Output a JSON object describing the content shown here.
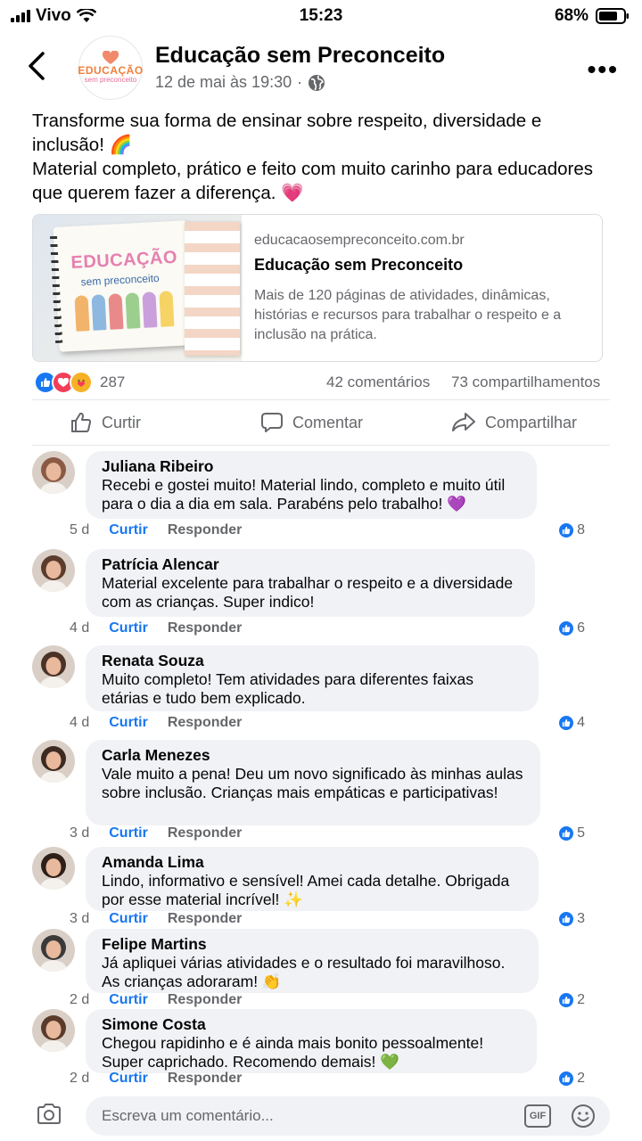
{
  "status_bar": {
    "carrier": "Vivo",
    "time": "15:23",
    "battery": "68%"
  },
  "post": {
    "page_name": "Educação sem Preconceito",
    "logo_line1": "EDUCAÇÃO",
    "logo_line2": "sem preconceito",
    "timestamp": "12 de mai às 19:30",
    "separator": "·",
    "text_line1": "Transforme sua forma de ensinar sobre respeito, diversidade e inclusão! 🌈",
    "text_line2": "Material completo, prático e feito com muito carinho para educadores que querem fazer a diferença. 💗",
    "link": {
      "domain": "educacaosempreconceito.com.br",
      "title": "Educação sem Preconceito",
      "description": "Mais de 120 páginas de atividades, dinâmicas, histórias e recursos para trabalhar o respeito e a inclusão na prática.",
      "image_title": "EDUCAÇÃO",
      "image_subtitle": "sem preconceito"
    },
    "reaction_count": "287",
    "comments_count": "42 comentários",
    "shares_count": "73 compartilhamentos"
  },
  "actions": {
    "like": "Curtir",
    "comment": "Comentar",
    "share": "Compartilhar"
  },
  "comment_actions": {
    "like": "Curtir",
    "reply": "Responder"
  },
  "comments": [
    {
      "name": "Juliana Ribeiro",
      "text": "Recebi e gostei muito! Material lindo, completo e muito útil para o dia a dia em sala. Parabéns pelo trabalho! 💜",
      "age": "5 d",
      "likes": "8",
      "avatar_color": "#8a5a44"
    },
    {
      "name": "Patrícia Alencar",
      "text": "Material excelente para trabalhar o respeito e a diversidade com as crianças. Super indico!",
      "age": "4 d",
      "likes": "6",
      "avatar_color": "#5b3b2c"
    },
    {
      "name": "Renata Souza",
      "text": "Muito completo! Tem atividades para diferentes faixas etárias e tudo bem explicado.",
      "age": "4 d",
      "likes": "4",
      "avatar_color": "#4a3226"
    },
    {
      "name": "Carla Menezes",
      "text": "Vale muito a pena! Deu um novo significado às minhas aulas sobre inclusão. Crianças mais empáticas e participativas!",
      "age": "3 d",
      "likes": "5",
      "avatar_color": "#3d2a20"
    },
    {
      "name": "Amanda Lima",
      "text": "Lindo, informativo e sensível! Amei cada detalhe. Obrigada por esse material incrível! ✨",
      "age": "3 d",
      "likes": "3",
      "avatar_color": "#2e1f18"
    },
    {
      "name": "Felipe Martins",
      "text": "Já apliquei várias atividades e o resultado foi maravilhoso. As crianças adoraram! 👏",
      "age": "2 d",
      "likes": "2",
      "avatar_color": "#3a3a3a"
    },
    {
      "name": "Simone Costa",
      "text": "Chegou rapidinho e é ainda mais bonito pessoalmente! Super caprichado. Recomendo demais! 💚",
      "age": "2 d",
      "likes": "2",
      "avatar_color": "#5a3a2a"
    }
  ],
  "composer": {
    "placeholder": "Escreva um comentário...",
    "gif": "GIF"
  },
  "icons": [
    "back-arrow-icon",
    "globe-icon",
    "more-icon",
    "like-icon",
    "comment-icon",
    "share-icon",
    "camera-icon",
    "gif-icon",
    "emoji-icon"
  ]
}
